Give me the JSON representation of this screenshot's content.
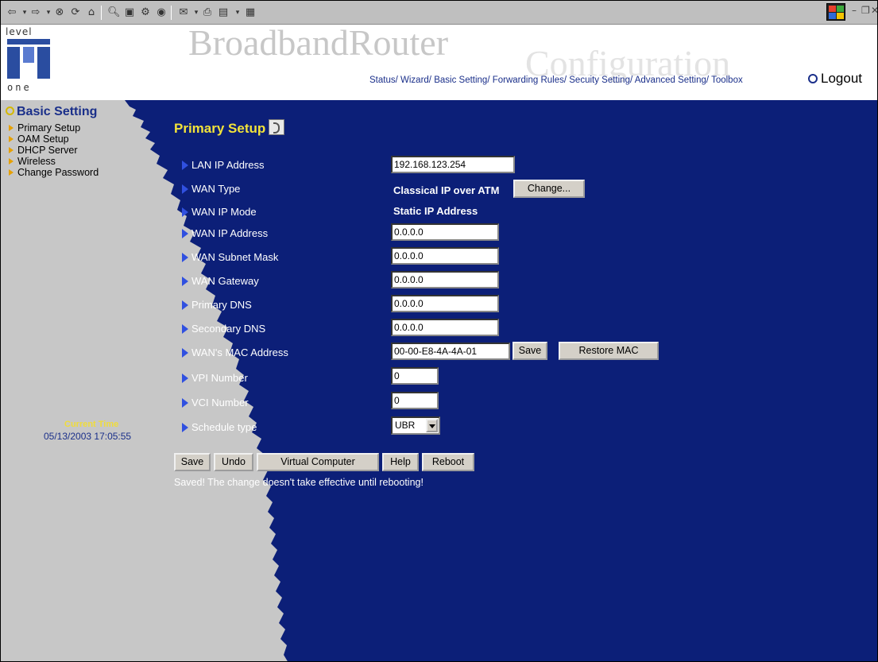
{
  "toolbar": {
    "icons": [
      "back-icon",
      "forward-icon",
      "stop-icon",
      "refresh-icon",
      "home-icon",
      "search-icon",
      "favorites-icon",
      "history-icon",
      "channels-icon",
      "mail-icon",
      "print-icon",
      "edit-icon",
      "discuss-icon"
    ]
  },
  "header": {
    "logo_top": "level",
    "logo_bottom": "one",
    "brand": "BroadbandRouter",
    "brand_watermark": "Configuration",
    "nav": [
      "Status/",
      "Wizard/",
      "Basic Setting/",
      "Forwarding Rules/",
      "Secuity Setting/",
      "Advanced Setting/",
      "Toolbox"
    ],
    "logout": "Logout"
  },
  "sidebar": {
    "title": "Basic Setting",
    "items": [
      {
        "label": "Primary Setup"
      },
      {
        "label": "OAM Setup"
      },
      {
        "label": "DHCP Server"
      },
      {
        "label": "Wireless"
      },
      {
        "label": "Change Password"
      }
    ],
    "current_time_label": "Current Time",
    "current_time": "05/13/2003 17:05:55"
  },
  "main": {
    "title": "Primary Setup",
    "fields": {
      "lan_ip": {
        "label": "LAN IP Address",
        "value": "192.168.123.254"
      },
      "wan_type": {
        "label": "WAN Type",
        "value": "Classical IP over ATM",
        "button": "Change..."
      },
      "wan_ip_mode": {
        "label": "WAN IP Mode",
        "value": "Static IP Address"
      },
      "wan_ip": {
        "label": "WAN IP Address",
        "value": "0.0.0.0"
      },
      "wan_mask": {
        "label": "WAN Subnet Mask",
        "value": "0.0.0.0"
      },
      "wan_gateway": {
        "label": "WAN Gateway",
        "value": "0.0.0.0"
      },
      "primary_dns": {
        "label": "Primary DNS",
        "value": "0.0.0.0"
      },
      "secondary_dns": {
        "label": "Secondary DNS",
        "value": "0.0.0.0"
      },
      "wan_mac": {
        "label": "WAN's MAC Address",
        "value": "00-00-E8-4A-4A-01",
        "save": "Save",
        "restore": "Restore MAC"
      },
      "vpi": {
        "label": "VPI Number",
        "value": "0"
      },
      "vci": {
        "label": "VCI Number",
        "value": "0"
      },
      "schedule": {
        "label": "Schedule type",
        "value": "UBR"
      }
    },
    "buttons": {
      "save": "Save",
      "undo": "Undo",
      "virtual": "Virtual Computer",
      "help": "Help",
      "reboot": "Reboot"
    },
    "status_message": "Saved! The change doesn't take effective until rebooting!"
  }
}
